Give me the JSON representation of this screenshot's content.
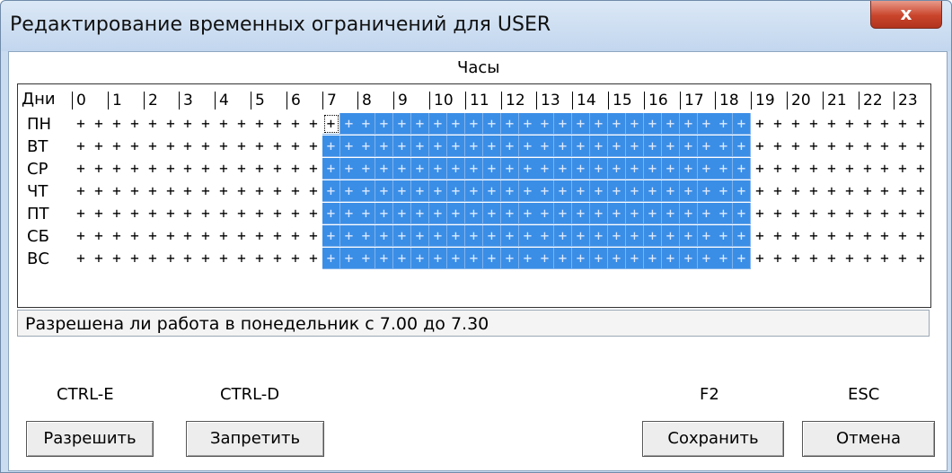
{
  "window": {
    "title": "Редактирование временных ограничений для USER",
    "close_label": "x"
  },
  "grid": {
    "hours_caption": "Часы",
    "days_caption": "Дни",
    "hours": [
      "0",
      "1",
      "2",
      "3",
      "4",
      "5",
      "6",
      "7",
      "8",
      "9",
      "10",
      "11",
      "12",
      "13",
      "14",
      "15",
      "16",
      "17",
      "18",
      "19",
      "20",
      "21",
      "22",
      "23"
    ],
    "days": [
      "ПН",
      "ВТ",
      "СР",
      "ЧТ",
      "ПТ",
      "СБ",
      "ВС"
    ],
    "cell_mark": "+",
    "selected_from_hour": 7,
    "selected_to_hour": 18,
    "focus_day": "ПН",
    "focus_time": "7.00"
  },
  "status": {
    "text": "Разрешена ли работа в понедельник с 7.00 до 7.30"
  },
  "buttons": {
    "allow": {
      "label": "Разрешить",
      "hotkey": "CTRL-E"
    },
    "deny": {
      "label": "Запретить",
      "hotkey": "CTRL-D"
    },
    "save": {
      "label": "Сохранить",
      "hotkey": "F2"
    },
    "cancel": {
      "label": "Отмена",
      "hotkey": "ESC"
    }
  },
  "colors": {
    "selection": "#3b8ee6",
    "title_bar": "#c9dcf0",
    "close_button": "#c9442b"
  }
}
